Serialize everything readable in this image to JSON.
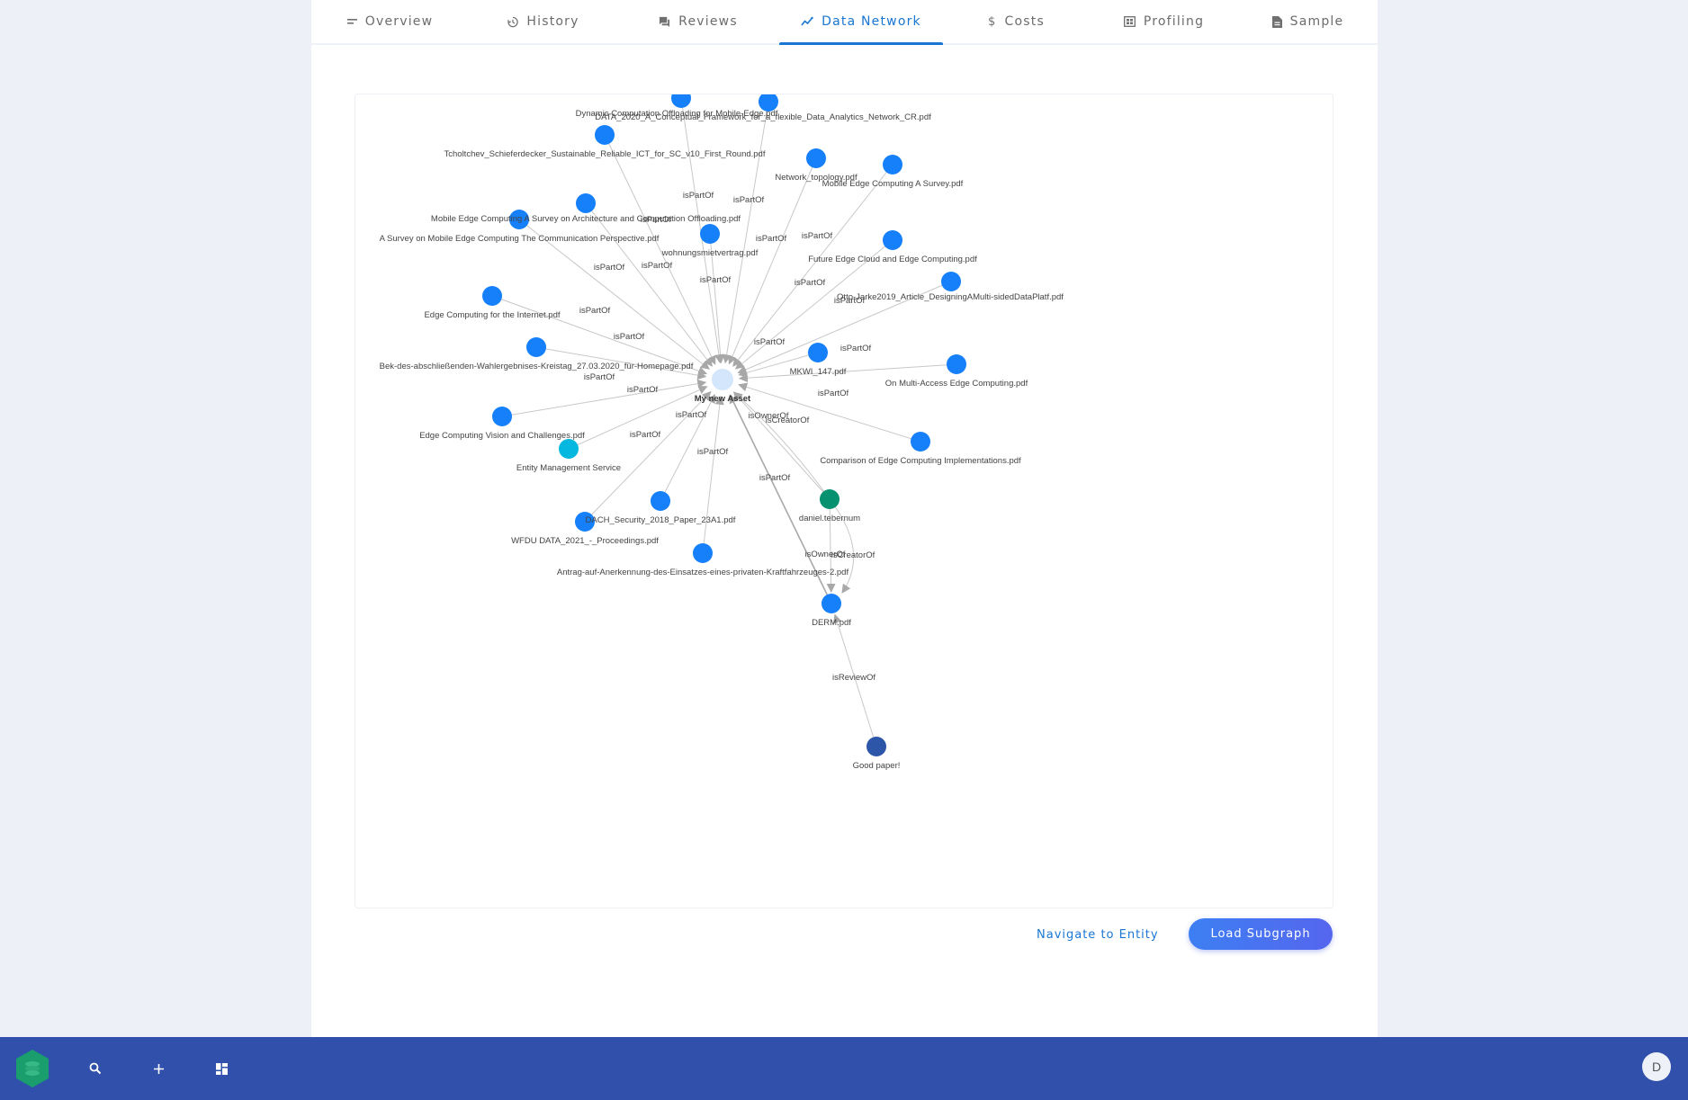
{
  "tabs": [
    {
      "label": "Overview",
      "icon": "overview-icon",
      "active": false
    },
    {
      "label": "History",
      "icon": "history-icon",
      "active": false
    },
    {
      "label": "Reviews",
      "icon": "reviews-icon",
      "active": false
    },
    {
      "label": "Data Network",
      "icon": "data-network-icon",
      "active": true
    },
    {
      "label": "Costs",
      "icon": "dollar-icon",
      "active": false
    },
    {
      "label": "Profiling",
      "icon": "profiling-icon",
      "active": false
    },
    {
      "label": "Sample",
      "icon": "document-icon",
      "active": false
    }
  ],
  "graph": {
    "colors": {
      "central": "#d4e6fb",
      "document": "#1580fa",
      "service": "#05b8df",
      "user": "#069171",
      "review": "#2e56a8",
      "edge": "#c8c8c8",
      "arrow": "#a8a8a8"
    },
    "nodes": [
      {
        "id": "asset",
        "label": "My new Asset",
        "type": "central"
      },
      {
        "id": "n1",
        "label": "Dynamic Computation Offloading for Mobile-Edge.pdf",
        "type": "document"
      },
      {
        "id": "n2",
        "label": "DATA_2020_A_Conceptual_Framework_for_a_flexible_Data_Analytics_Network_CR.pdf",
        "type": "document"
      },
      {
        "id": "n3",
        "label": "Tcholtchev_Schieferdecker_Sustainable_Reliable_ICT_for_SC_v10_First_Round.pdf",
        "type": "document"
      },
      {
        "id": "n4",
        "label": "Network_topology.pdf",
        "type": "document"
      },
      {
        "id": "n5",
        "label": "Mobile Edge Computing A Survey.pdf",
        "type": "document"
      },
      {
        "id": "n6",
        "label": "Mobile Edge Computing A Survey on Architecture and Computation Offloading.pdf",
        "type": "document"
      },
      {
        "id": "n7",
        "label": "A Survey on Mobile Edge Computing The Communication Perspective.pdf",
        "type": "document"
      },
      {
        "id": "n8",
        "label": "wohnungsmietvertrag.pdf",
        "type": "document"
      },
      {
        "id": "n9",
        "label": "Future Edge Cloud and Edge Computing.pdf",
        "type": "document"
      },
      {
        "id": "n10",
        "label": "Otto-Jarke2019_Article_DesigningAMulti-sidedDataPlatf.pdf",
        "type": "document"
      },
      {
        "id": "n11",
        "label": "Edge Computing for the Internet.pdf",
        "type": "document"
      },
      {
        "id": "n12",
        "label": "Bek-des-abschließenden-Wahlergebnises-Kreistag_27.03.2020_für-Homepage.pdf",
        "type": "document"
      },
      {
        "id": "n13",
        "label": "MKWI_147.pdf",
        "type": "document"
      },
      {
        "id": "n14",
        "label": "On Multi-Access Edge Computing.pdf",
        "type": "document"
      },
      {
        "id": "n15",
        "label": "Edge Computing Vision and Challenges.pdf",
        "type": "document"
      },
      {
        "id": "n16",
        "label": "Entity Management Service",
        "type": "service"
      },
      {
        "id": "n17",
        "label": "Comparison of Edge Computing Implementations.pdf",
        "type": "document"
      },
      {
        "id": "n18",
        "label": "daniel.tebernum",
        "type": "user"
      },
      {
        "id": "n19",
        "label": "DACH_Security_2018_Paper_23A1.pdf",
        "type": "document"
      },
      {
        "id": "n20",
        "label": "WFDU DATA_2021_-_Proceedings.pdf",
        "type": "document"
      },
      {
        "id": "n21",
        "label": "Antrag-auf-Anerkennung-des-Einsatzes-eines-privaten-Kraftfahrzeuges-2.pdf",
        "type": "document"
      },
      {
        "id": "n22",
        "label": "DERM.pdf",
        "type": "document"
      },
      {
        "id": "n23",
        "label": "Good paper!",
        "type": "review"
      }
    ],
    "edges": [
      {
        "from": "n1",
        "to": "asset",
        "label": "isPartOf"
      },
      {
        "from": "n2",
        "to": "asset",
        "label": "isPartOf"
      },
      {
        "from": "n3",
        "to": "asset",
        "label": "isPartOf"
      },
      {
        "from": "n4",
        "to": "asset",
        "label": "isPartOf"
      },
      {
        "from": "n5",
        "to": "asset",
        "label": "isPartOf"
      },
      {
        "from": "n6",
        "to": "asset",
        "label": "isPartOf"
      },
      {
        "from": "n7",
        "to": "asset",
        "label": "isPartOf"
      },
      {
        "from": "n8",
        "to": "asset",
        "label": "isPartOf"
      },
      {
        "from": "n9",
        "to": "asset",
        "label": "isPartOf"
      },
      {
        "from": "n10",
        "to": "asset",
        "label": "isPartOf"
      },
      {
        "from": "n11",
        "to": "asset",
        "label": "isPartOf"
      },
      {
        "from": "n12",
        "to": "asset",
        "label": "isPartOf"
      },
      {
        "from": "n13",
        "to": "asset",
        "label": "isPartOf"
      },
      {
        "from": "n14",
        "to": "asset",
        "label": "isPartOf"
      },
      {
        "from": "n15",
        "to": "asset",
        "label": "isPartOf"
      },
      {
        "from": "n16",
        "to": "asset",
        "label": "isPartOf"
      },
      {
        "from": "n17",
        "to": "asset",
        "label": "isPartOf"
      },
      {
        "from": "n19",
        "to": "asset",
        "label": "isPartOf"
      },
      {
        "from": "n20",
        "to": "asset",
        "label": "isPartOf"
      },
      {
        "from": "n21",
        "to": "asset",
        "label": "isPartOf"
      },
      {
        "from": "n22",
        "to": "asset",
        "label": "isPartOf"
      },
      {
        "from": "n18",
        "to": "asset",
        "label": "isOwnerOf"
      },
      {
        "from": "n18",
        "to": "asset",
        "label": "isCreatorOf"
      },
      {
        "from": "n18",
        "to": "n22",
        "label": "isOwnerOf"
      },
      {
        "from": "n18",
        "to": "n22",
        "label": "isCreatorOf"
      },
      {
        "from": "n23",
        "to": "n22",
        "label": "isReviewOf"
      }
    ]
  },
  "actions": {
    "navigate_label": "Navigate to Entity",
    "load_label": "Load Subgraph"
  },
  "bottombar": {
    "items": [
      "search-icon",
      "add-icon",
      "dashboard-icon"
    ],
    "avatar_initial": "D"
  }
}
